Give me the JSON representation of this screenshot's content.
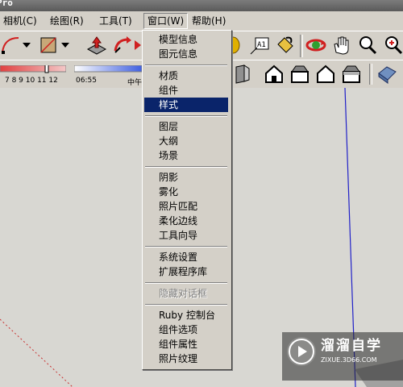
{
  "title_fragment": "Pro",
  "menubar": [
    {
      "label": "相机(C)"
    },
    {
      "label": "绘图(R)"
    },
    {
      "label": "工具(T)"
    },
    {
      "label": "窗口(W)"
    },
    {
      "label": "帮助(H)"
    }
  ],
  "window_menu": {
    "items": [
      {
        "label": "模型信息"
      },
      {
        "label": "图元信息"
      },
      {
        "label": "材质"
      },
      {
        "label": "组件"
      },
      {
        "label": "样式"
      },
      {
        "label": "图层"
      },
      {
        "label": "大纲"
      },
      {
        "label": "场景"
      },
      {
        "label": "阴影"
      },
      {
        "label": "雾化"
      },
      {
        "label": "照片匹配"
      },
      {
        "label": "柔化边线"
      },
      {
        "label": "工具向导"
      },
      {
        "label": "系统设置"
      },
      {
        "label": "扩展程序库"
      },
      {
        "label": "隐藏对话框"
      },
      {
        "label": "Ruby 控制台"
      },
      {
        "label": "组件选项"
      },
      {
        "label": "组件属性"
      },
      {
        "label": "照片纹理"
      }
    ]
  },
  "shadow_bar": {
    "months": "7 8 9 10 11 12",
    "time": "06:55",
    "noon": "中午"
  },
  "watermark": {
    "name": "溜溜自学",
    "url": "ZIXUE.3D66.COM"
  },
  "icons": [
    "arc-icon",
    "rectangle-icon",
    "push-pull-icon",
    "follow-me-icon",
    "model-info-icon",
    "text-label-icon",
    "paint-bucket-icon",
    "orbit-icon",
    "pan-icon",
    "zoom-icon",
    "zoom-extents-icon",
    "iso-view-icon",
    "top-view-icon",
    "front-view-icon",
    "right-view-icon",
    "back-view-icon",
    "left-view-icon",
    "xray-icon"
  ],
  "colors": {
    "selection": "#0a246a",
    "axis_blue": "#2020c8",
    "axis_red": "#c83030"
  }
}
